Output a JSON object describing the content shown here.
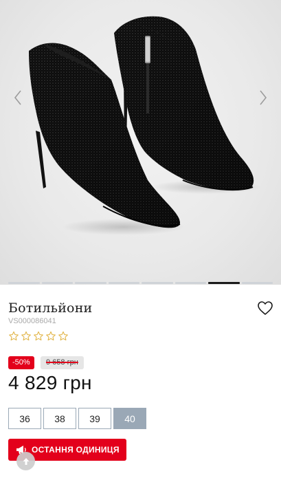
{
  "product": {
    "title": "Ботильйони",
    "sku": "VS000086041",
    "rating": {
      "value": 0,
      "max": 5
    },
    "discount": "-50%",
    "old_price": "9 658 грн",
    "price": "4 829 грн"
  },
  "gallery": {
    "slide_count": 8,
    "active_slide": 6
  },
  "sizes": {
    "options": [
      "36",
      "38",
      "39",
      "40"
    ],
    "selected": "40"
  },
  "notice": {
    "label": "ОСТАННЯ ОДИНИЦЯ"
  },
  "icons": {
    "prev": "chevron-left-icon",
    "next": "chevron-right-icon",
    "wishlist": "heart-icon",
    "star": "star-outline-icon",
    "notice": "megaphone-icon",
    "scroll_top": "arrow-up-icon"
  },
  "colors": {
    "accent_red": "#e3001b",
    "size_selected": "#9aa8b6",
    "star": "#e2b64a"
  }
}
